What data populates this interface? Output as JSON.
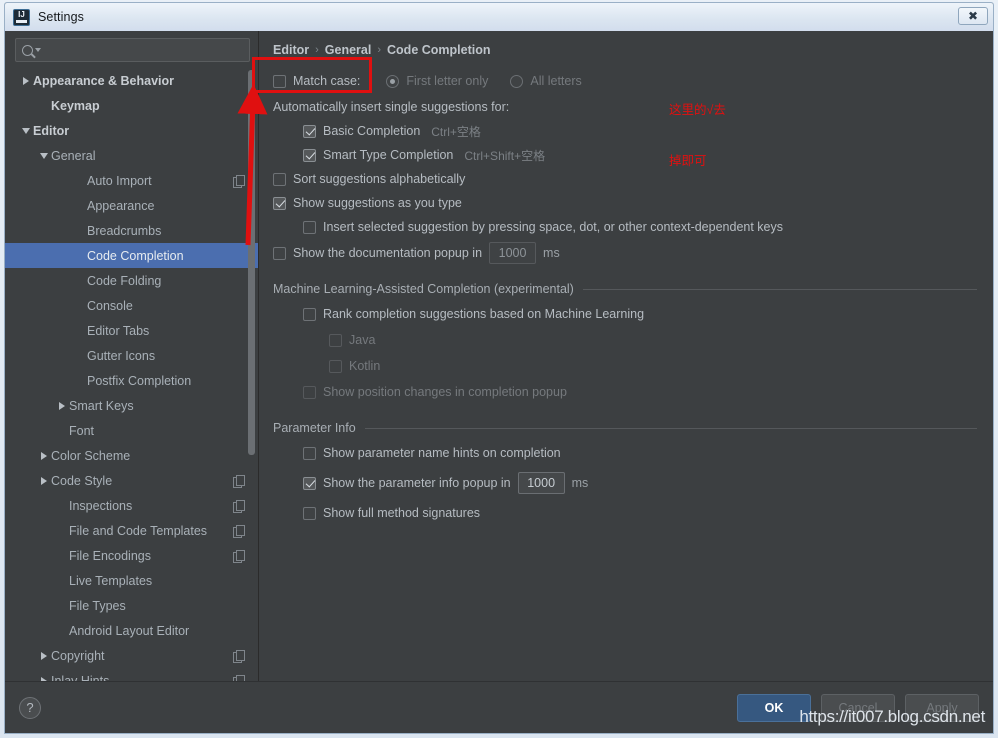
{
  "window": {
    "title": "Settings",
    "logo_icon": "intellij-idea-logo",
    "close_label": "✖"
  },
  "sidebar": {
    "search": {
      "value": "",
      "placeholder": "",
      "icon": "search-icon"
    },
    "items": [
      {
        "label": "Appearance & Behavior",
        "indent": 0,
        "twisty": "collapsed",
        "bold": true,
        "selected": false,
        "copy": false
      },
      {
        "label": "Keymap",
        "indent": 1,
        "twisty": "none",
        "bold": true,
        "selected": false,
        "copy": false
      },
      {
        "label": "Editor",
        "indent": 0,
        "twisty": "expanded",
        "bold": true,
        "selected": false,
        "copy": false
      },
      {
        "label": "General",
        "indent": 1,
        "twisty": "expanded",
        "bold": false,
        "selected": false,
        "copy": false
      },
      {
        "label": "Auto Import",
        "indent": 3,
        "twisty": "none",
        "bold": false,
        "selected": false,
        "copy": true
      },
      {
        "label": "Appearance",
        "indent": 3,
        "twisty": "none",
        "bold": false,
        "selected": false,
        "copy": false
      },
      {
        "label": "Breadcrumbs",
        "indent": 3,
        "twisty": "none",
        "bold": false,
        "selected": false,
        "copy": false
      },
      {
        "label": "Code Completion",
        "indent": 3,
        "twisty": "none",
        "bold": false,
        "selected": true,
        "copy": false
      },
      {
        "label": "Code Folding",
        "indent": 3,
        "twisty": "none",
        "bold": false,
        "selected": false,
        "copy": false
      },
      {
        "label": "Console",
        "indent": 3,
        "twisty": "none",
        "bold": false,
        "selected": false,
        "copy": false
      },
      {
        "label": "Editor Tabs",
        "indent": 3,
        "twisty": "none",
        "bold": false,
        "selected": false,
        "copy": false
      },
      {
        "label": "Gutter Icons",
        "indent": 3,
        "twisty": "none",
        "bold": false,
        "selected": false,
        "copy": false
      },
      {
        "label": "Postfix Completion",
        "indent": 3,
        "twisty": "none",
        "bold": false,
        "selected": false,
        "copy": false
      },
      {
        "label": "Smart Keys",
        "indent": 2,
        "twisty": "collapsed",
        "bold": false,
        "selected": false,
        "copy": false
      },
      {
        "label": "Font",
        "indent": 2,
        "twisty": "none",
        "bold": false,
        "selected": false,
        "copy": false
      },
      {
        "label": "Color Scheme",
        "indent": 1,
        "twisty": "collapsed",
        "bold": false,
        "selected": false,
        "copy": false
      },
      {
        "label": "Code Style",
        "indent": 1,
        "twisty": "collapsed",
        "bold": false,
        "selected": false,
        "copy": true
      },
      {
        "label": "Inspections",
        "indent": 2,
        "twisty": "none",
        "bold": false,
        "selected": false,
        "copy": true
      },
      {
        "label": "File and Code Templates",
        "indent": 2,
        "twisty": "none",
        "bold": false,
        "selected": false,
        "copy": true
      },
      {
        "label": "File Encodings",
        "indent": 2,
        "twisty": "none",
        "bold": false,
        "selected": false,
        "copy": true
      },
      {
        "label": "Live Templates",
        "indent": 2,
        "twisty": "none",
        "bold": false,
        "selected": false,
        "copy": false
      },
      {
        "label": "File Types",
        "indent": 2,
        "twisty": "none",
        "bold": false,
        "selected": false,
        "copy": false
      },
      {
        "label": "Android Layout Editor",
        "indent": 2,
        "twisty": "none",
        "bold": false,
        "selected": false,
        "copy": false
      },
      {
        "label": "Copyright",
        "indent": 1,
        "twisty": "collapsed",
        "bold": false,
        "selected": false,
        "copy": true
      },
      {
        "label": "Inlay Hints",
        "indent": 1,
        "twisty": "collapsed",
        "bold": false,
        "selected": false,
        "copy": true
      }
    ]
  },
  "main": {
    "breadcrumb": {
      "part1": "Editor",
      "sep1": "›",
      "part2": "General",
      "sep2": "›",
      "part3": "Code Completion"
    },
    "match_case": {
      "label": "Match case:",
      "checked": false
    },
    "first_letter_only": {
      "label": "First letter only",
      "selected": true
    },
    "all_letters": {
      "label": "All letters",
      "selected": false
    },
    "auto_insert_header": "Automatically insert single suggestions for:",
    "basic_completion": {
      "label": "Basic Completion",
      "shortcut": "Ctrl+空格",
      "checked": true
    },
    "smart_type_completion": {
      "label": "Smart Type Completion",
      "shortcut": "Ctrl+Shift+空格",
      "checked": true
    },
    "sort_alphabetically": {
      "label": "Sort suggestions alphabetically",
      "checked": false
    },
    "show_as_you_type": {
      "label": "Show suggestions as you type",
      "checked": true
    },
    "insert_selected": {
      "label": "Insert selected suggestion by pressing space, dot, or other context-dependent keys",
      "checked": false
    },
    "doc_popup": {
      "label": "Show the documentation popup in",
      "value": "1000",
      "unit": "ms",
      "checked": false
    },
    "ml_section": "Machine Learning-Assisted Completion (experimental)",
    "ml_rank": {
      "label": "Rank completion suggestions based on Machine Learning",
      "checked": false
    },
    "ml_java": {
      "label": "Java",
      "checked": false
    },
    "ml_kotlin": {
      "label": "Kotlin",
      "checked": false
    },
    "ml_position_changes": {
      "label": "Show position changes in completion popup",
      "checked": false
    },
    "param_section": "Parameter Info",
    "param_hints": {
      "label": "Show parameter name hints on completion",
      "checked": false
    },
    "param_popup": {
      "label": "Show the parameter info popup in",
      "value": "1000",
      "unit": "ms",
      "checked": true
    },
    "full_signatures": {
      "label": "Show full method signatures",
      "checked": false
    }
  },
  "footer": {
    "help_label": "?",
    "ok_label": "OK",
    "cancel_label": "Cancel",
    "apply_label": "Apply",
    "watermark": "https://it007.blog.csdn.net"
  },
  "annotations": {
    "note_line1": "这里的√去",
    "note_line2": "掉即可",
    "accent_color": "#e01010"
  }
}
